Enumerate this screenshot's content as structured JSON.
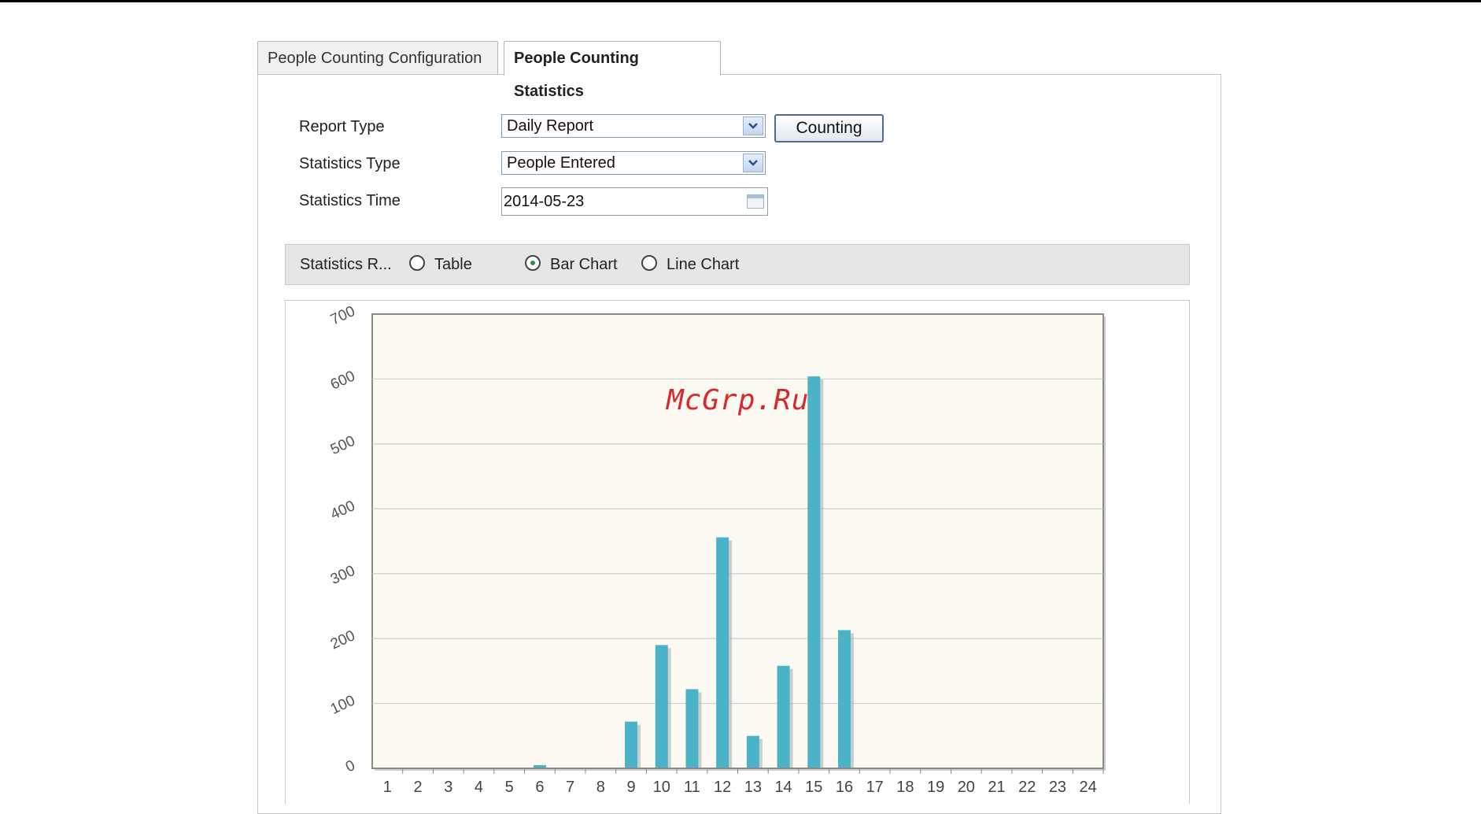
{
  "tabs": {
    "config": "People Counting Configuration",
    "stats": "People Counting Statistics"
  },
  "form": {
    "report_type_label": "Report Type",
    "report_type_value": "Daily Report",
    "statistics_type_label": "Statistics Type",
    "statistics_type_value": "People Entered",
    "statistics_time_label": "Statistics Time",
    "statistics_time_value": "2014-05-23",
    "counting_button": "Counting"
  },
  "result_options": {
    "label": "Statistics R...",
    "table": "Table",
    "bar_chart": "Bar Chart",
    "line_chart": "Line Chart",
    "selected": "Bar Chart"
  },
  "watermark": "McGrp.Ru",
  "colors": {
    "bar": "#4ab3c8",
    "plot_background": "#fcfaf2",
    "radio_selected": "#2f8f3b",
    "watermark": "#d8282c"
  },
  "chart_data": {
    "type": "bar",
    "categories": [
      "1",
      "2",
      "3",
      "4",
      "5",
      "6",
      "7",
      "8",
      "9",
      "10",
      "11",
      "12",
      "13",
      "14",
      "15",
      "16",
      "17",
      "18",
      "19",
      "20",
      "21",
      "22",
      "23",
      "24"
    ],
    "values": [
      0,
      0,
      0,
      0,
      0,
      5,
      0,
      0,
      72,
      190,
      122,
      356,
      50,
      158,
      604,
      213,
      0,
      0,
      0,
      0,
      0,
      0,
      0,
      0
    ],
    "yticks": [
      "0",
      "100",
      "200",
      "300",
      "400",
      "500",
      "600",
      "700"
    ],
    "ylim": [
      0,
      700
    ],
    "grid": true,
    "legend": "none"
  }
}
